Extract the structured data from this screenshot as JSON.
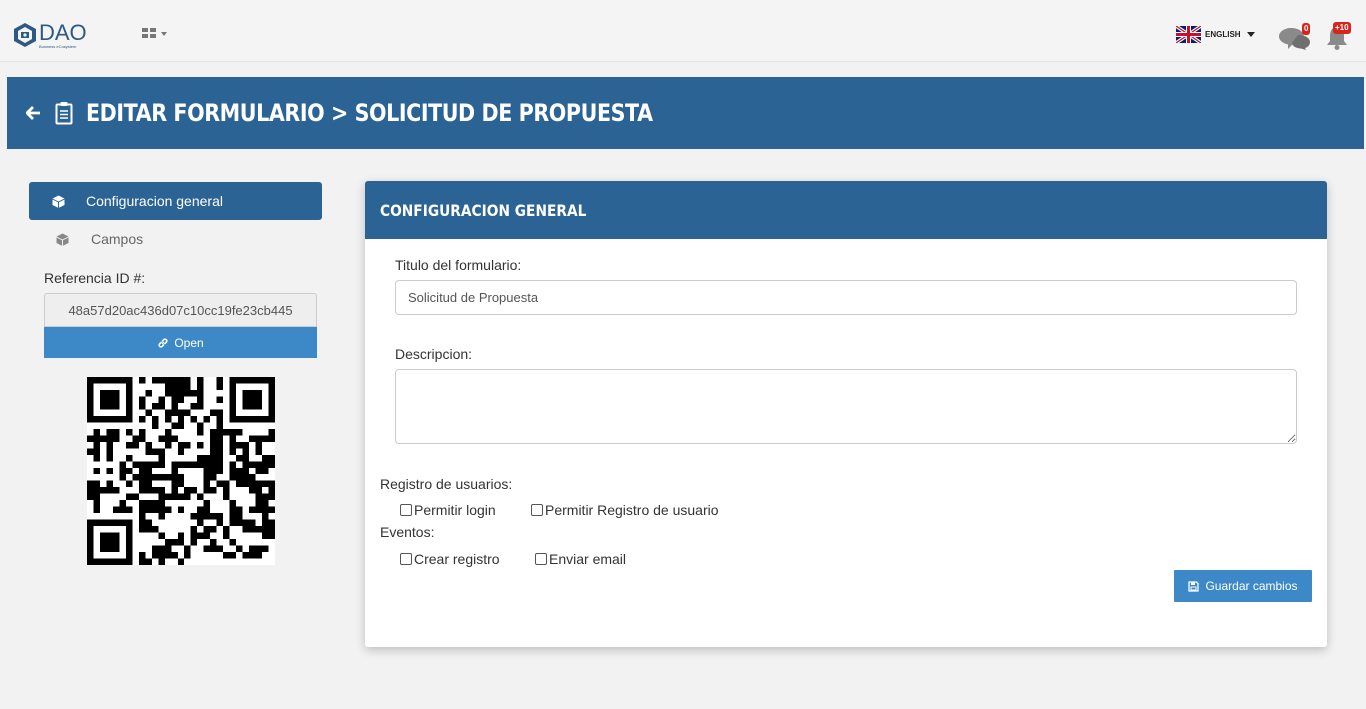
{
  "brand": {
    "name": "DAO",
    "tagline": "Business eCosystem"
  },
  "topbar": {
    "language_label": "ENGLISH",
    "messages_count": "0",
    "notifications_count": "+10"
  },
  "page": {
    "title": "EDITAR FORMULARIO > SOLICITUD DE PROPUESTA"
  },
  "sidebar": {
    "items": [
      {
        "label": "Configuracion general",
        "active": true
      },
      {
        "label": "Campos",
        "active": false
      }
    ],
    "reference_label": "Referencia ID #:",
    "reference_value": "48a57d20ac436d07c10cc19fe23cb445",
    "open_button": "Open"
  },
  "card": {
    "title": "CONFIGURACION GENERAL",
    "form_title_label": "Titulo del formulario:",
    "form_title_value": "Solicitud de Propuesta",
    "description_label": "Descripcion:",
    "description_value": "",
    "user_registration_label": "Registro de usuarios:",
    "user_registration_options": [
      {
        "label": "Permitir login",
        "checked": false
      },
      {
        "label": "Permitir Registro de usuario",
        "checked": false
      }
    ],
    "events_label": "Eventos:",
    "events_options": [
      {
        "label": "Crear registro",
        "checked": false
      },
      {
        "label": "Enviar email",
        "checked": false
      }
    ],
    "save_button": "Guardar cambios"
  },
  "colors": {
    "primary": "#2b6394",
    "button": "#3d89c8",
    "badge": "#d9241c"
  }
}
